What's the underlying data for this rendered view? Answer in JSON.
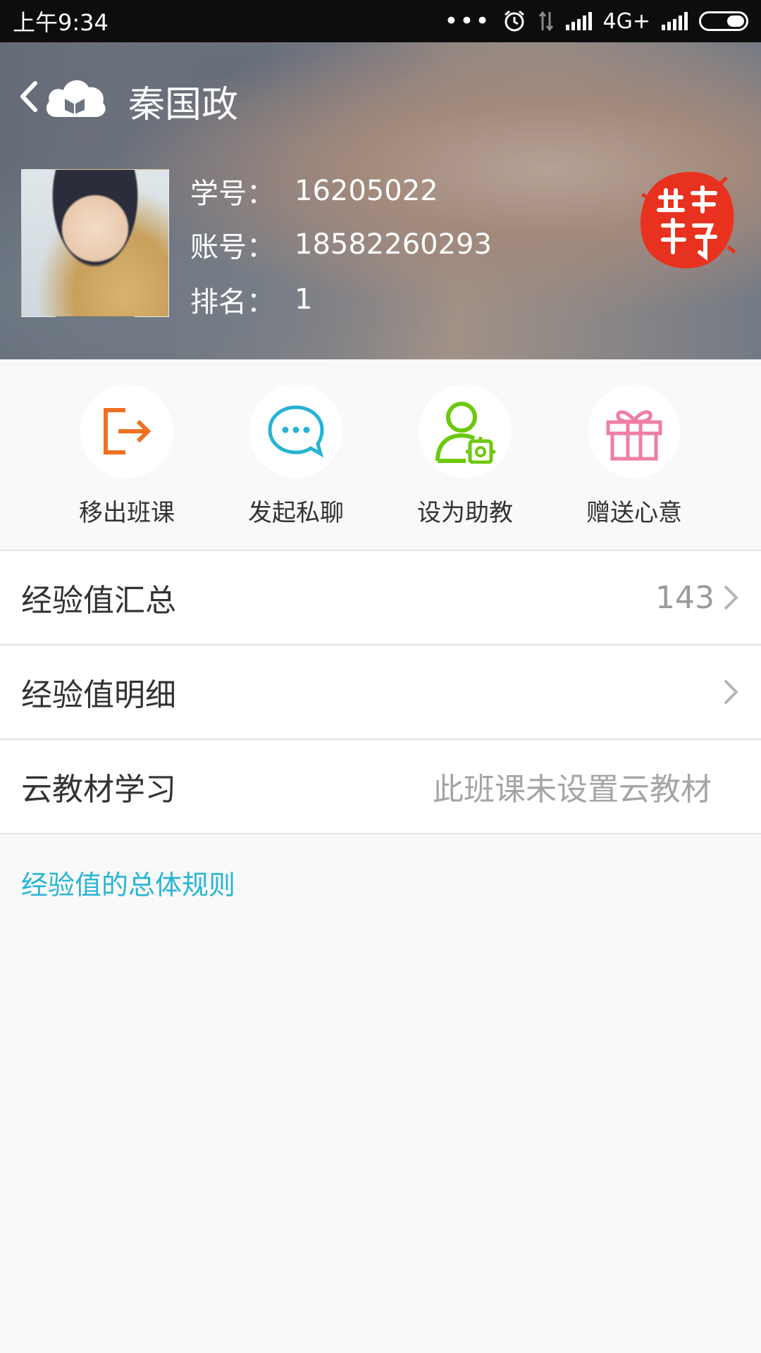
{
  "status_bar": {
    "time": "上午9:34",
    "dots": "•••",
    "network": "4G+"
  },
  "header": {
    "title": "秦国政",
    "info": [
      {
        "label": "学号：",
        "value": "16205022"
      },
      {
        "label": "账号：",
        "value": "18582260293"
      },
      {
        "label": "排名：",
        "value": "1"
      }
    ],
    "stamp_text": "最佳学霸"
  },
  "actions": [
    {
      "label": "移出班课",
      "icon": "exit-icon",
      "color": "#f07022"
    },
    {
      "label": "发起私聊",
      "icon": "chat-icon",
      "color": "#25b3d3"
    },
    {
      "label": "设为助教",
      "icon": "user-settings-icon",
      "color": "#6cc80c"
    },
    {
      "label": "赠送心意",
      "icon": "gift-icon",
      "color": "#f07ea3"
    }
  ],
  "list": {
    "exp_total": {
      "label": "经验值汇总",
      "value": "143"
    },
    "exp_detail": {
      "label": "经验值明细"
    },
    "cloud_study": {
      "label": "云教材学习",
      "hint": "此班课未设置云教材"
    }
  },
  "rules_link": "经验值的总体规则",
  "colors": {
    "accent": "#29b5d3",
    "stamp": "#e8321f"
  }
}
